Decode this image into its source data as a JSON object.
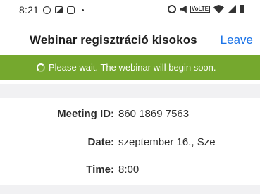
{
  "status_bar": {
    "time": "8:21",
    "left_icons": [
      "whatsapp-icon",
      "gallery-icon",
      "instagram-icon",
      "dot-icon"
    ],
    "right_icons": [
      "alarm-icon",
      "mute-icon",
      "volte-icon",
      "wifi-icon",
      "signal-icon",
      "battery-icon"
    ],
    "volte_label": "VoLTE"
  },
  "header": {
    "title": "Webinar regisztráció kisokos",
    "leave_label": "Leave"
  },
  "banner": {
    "message": "Please wait. The webinar will begin soon.",
    "color": "#75a82e"
  },
  "info": {
    "meeting_id_label": "Meeting ID:",
    "meeting_id_value": "860 1869 7563",
    "date_label": "Date:",
    "date_value": "szeptember 16., Sze",
    "time_label": "Time:",
    "time_value": "8:00"
  },
  "colors": {
    "accent": "#1a73e8",
    "band": "#f1f1f3"
  }
}
